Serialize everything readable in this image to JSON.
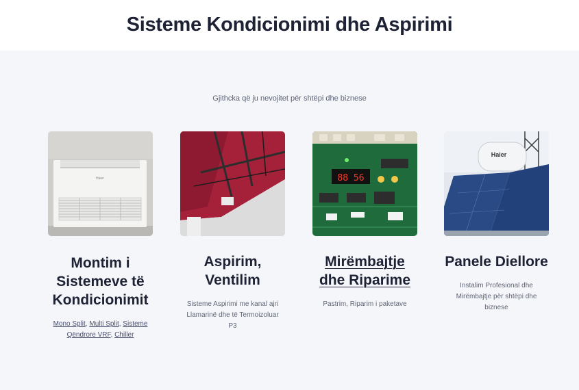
{
  "header": {
    "title": "Sisteme Kondicionimi dhe Aspirimi"
  },
  "section": {
    "subtitle": "Gjithcka që ju nevojitet për shtëpi dhe biznese"
  },
  "cards": [
    {
      "title": "Montim i Sistemeve të Kondicionimit",
      "links": [
        "Mono Split",
        "Multi Split",
        "Sisteme Qëndrore VRF",
        "Chiller"
      ],
      "separator": ", "
    },
    {
      "title": "Aspirim, Ventilim",
      "desc": "Sisteme Aspirimi me kanal ajri Llamarinë dhe të Termoizoluar P3"
    },
    {
      "title": "Mirëmbajtje dhe Riparime",
      "desc": "Pastrim, Riparim i paketave"
    },
    {
      "title": "Panele Diellore",
      "desc": "Instalim Profesional dhe Mirëmbajtje për shtëpi dhe biznese"
    }
  ],
  "images": {
    "ac_brand": "Haier",
    "board_display": "88 56",
    "heater_brand": "Haier"
  }
}
